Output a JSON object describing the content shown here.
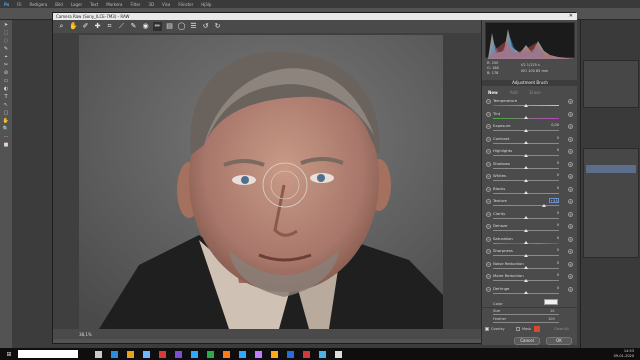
{
  "photoshop": {
    "menu": [
      "Ps",
      "Fil",
      "Redigera",
      "Bild",
      "Lager",
      "Text",
      "Markera",
      "Filter",
      "3D",
      "Visa",
      "Fönster",
      "Hjälp"
    ],
    "status_zoom": "66,67%",
    "status_size": "Dok: 34,3M/34,3M"
  },
  "camera_raw": {
    "title": "Camera Raw (Sony_ILCE-7M3) - RAW",
    "close_label": "✕",
    "tools": [
      "zoom-icon",
      "hand-icon",
      "white-balance-icon",
      "color-sampler-icon",
      "crop-icon",
      "straighten-icon",
      "spot-removal-icon",
      "red-eye-icon",
      "adjustment-brush-icon",
      "graduated-filter-icon",
      "radial-filter-icon",
      "preferences-icon",
      "rotate-left-icon",
      "rotate-right-icon"
    ],
    "active_tool": "adjustment-brush-icon",
    "zoom_level": "38,1%",
    "rgb_readout": {
      "r_label": "R:",
      "r": "200",
      "g_label": "G:",
      "g": "188",
      "b_label": "B:",
      "b": "178",
      "exposure": "f/2  1/125 s",
      "iso": "ISO 100  85 mm"
    },
    "panel_title": "Adjustment Brush",
    "modes": [
      "New",
      "Add",
      "Erase"
    ],
    "sliders": [
      {
        "label": "Temperature",
        "value": "",
        "pos": 0.5
      },
      {
        "label": "Tint",
        "value": "",
        "pos": 0.5
      },
      {
        "label": "Exposure",
        "value": "0,00",
        "pos": 0.5
      },
      {
        "label": "Contrast",
        "value": "0",
        "pos": 0.5
      },
      {
        "label": "Highlights",
        "value": "0",
        "pos": 0.5
      },
      {
        "label": "Shadows",
        "value": "0",
        "pos": 0.5
      },
      {
        "label": "Whites",
        "value": "0",
        "pos": 0.5
      },
      {
        "label": "Blacks",
        "value": "0",
        "pos": 0.5
      },
      {
        "label": "Texture",
        "value": "+55",
        "pos": 0.78,
        "focused": true
      },
      {
        "label": "Clarity",
        "value": "0",
        "pos": 0.5
      },
      {
        "label": "Dehaze",
        "value": "0",
        "pos": 0.5
      },
      {
        "label": "Saturation",
        "value": "0",
        "pos": 0.5
      },
      {
        "label": "Sharpness",
        "value": "0",
        "pos": 0.5
      },
      {
        "label": "Noise Reduction",
        "value": "0",
        "pos": 0.5
      },
      {
        "label": "Moire Reduction",
        "value": "0",
        "pos": 0.5
      },
      {
        "label": "Defringe",
        "value": "0",
        "pos": 0.5
      }
    ],
    "color_label": "Color",
    "size": {
      "label": "Size",
      "value": "10"
    },
    "feather": {
      "label": "Feather",
      "value": "100"
    },
    "overlay_label": "Overlay",
    "mask_label": "Mask",
    "clear_all": "Clear All",
    "cancel": "Cancel",
    "ok": "OK",
    "accent": "#6a8fd1"
  },
  "taskbar": {
    "clock_time": "14:53",
    "clock_date": "09-01-2020"
  }
}
